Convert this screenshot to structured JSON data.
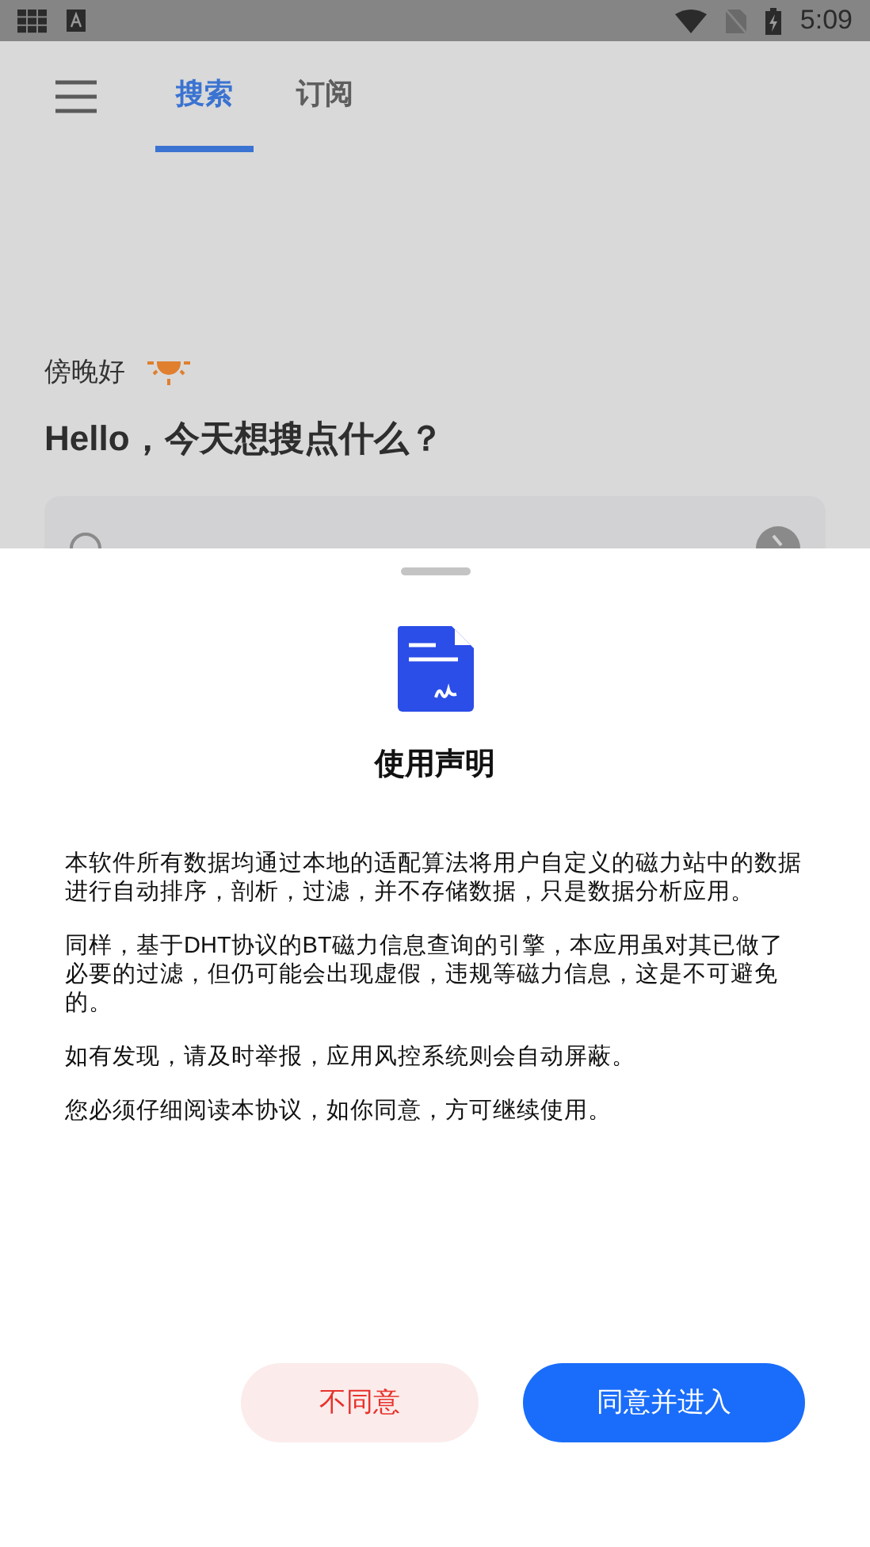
{
  "status_bar": {
    "time": "5:09"
  },
  "tabs": [
    {
      "label": "搜索",
      "selected": true
    },
    {
      "label": "订阅",
      "selected": false
    }
  ],
  "greeting": "傍晚好",
  "headline": "Hello，今天想搜点什么？",
  "dialog": {
    "title": "使用声明",
    "paragraphs": [
      "本软件所有数据均通过本地的适配算法将用户自定义的磁力站中的数据进行自动排序，剖析，过滤，并不存储数据，只是数据分析应用。",
      "同样，基于DHT协议的BT磁力信息查询的引擎，本应用虽对其已做了必要的过滤，但仍可能会出现虚假，违规等磁力信息，这是不可避免的。",
      "如有发现，请及时举报，应用风控系统则会自动屏蔽。",
      "您必须仔细阅读本协议，如你同意，方可继续使用。"
    ],
    "buttons": [
      {
        "label": "不同意",
        "kind": "decline"
      },
      {
        "label": "同意并进入",
        "kind": "accept"
      }
    ]
  }
}
